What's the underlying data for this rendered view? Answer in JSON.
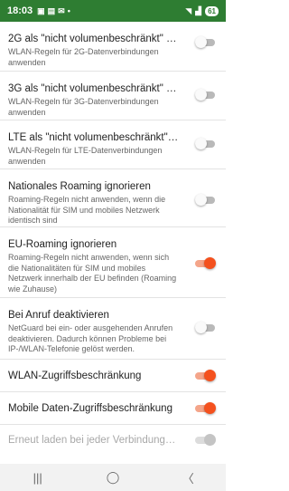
{
  "status_bar": {
    "time": "18:03",
    "left_icons": [
      "app-notification-icon",
      "image-notification-icon",
      "message-notification-icon",
      "dot-icon"
    ],
    "battery": "61",
    "accent": "#2e7d32"
  },
  "settings": [
    {
      "title": "2G als \"nicht volumenbeschränkt\" betra…",
      "desc": "WLAN-Regeln für 2G-Datenverbindungen anwenden",
      "state": "off"
    },
    {
      "title": "3G als \"nicht volumenbeschränkt\" betra…",
      "desc": "WLAN-Regeln für 3G-Datenverbindungen anwenden",
      "state": "off"
    },
    {
      "title": "LTE als \"nicht volumenbeschränkt\" betr…",
      "desc": "WLAN-Regeln für LTE-Datenverbindungen anwenden",
      "state": "off"
    },
    {
      "title": "Nationales Roaming ignorieren",
      "desc": "Roaming-Regeln nicht anwenden, wenn die Nationalität für SIM und mobiles Netzwerk identisch sind",
      "state": "off"
    },
    {
      "title": "EU-Roaming ignorieren",
      "desc": "Roaming-Regeln nicht anwenden, wenn sich die Nationalitäten für SIM und mobiles Netzwerk innerhalb der EU befinden (Roaming wie Zuhause)",
      "state": "on"
    },
    {
      "title": "Bei Anruf deaktivieren",
      "desc": "NetGuard bei ein- oder ausgehenden Anrufen deaktivieren. Dadurch können Probleme bei IP-/WLAN-Telefonie gelöst werden.",
      "state": "off"
    },
    {
      "title": "WLAN-Zugriffsbeschränkung",
      "desc": "",
      "state": "on"
    },
    {
      "title": "Mobile Daten-Zugriffsbeschränkung",
      "desc": "",
      "state": "on"
    },
    {
      "title": "Erneut laden bei jeder Verbindungsände…",
      "desc": "",
      "state": "disabled"
    }
  ],
  "colors": {
    "toggle_on": "#f4511e",
    "toggle_off": "#b9b9b9"
  },
  "nav_bar": {
    "recents": "|||",
    "home": "◯",
    "back": "〈"
  }
}
